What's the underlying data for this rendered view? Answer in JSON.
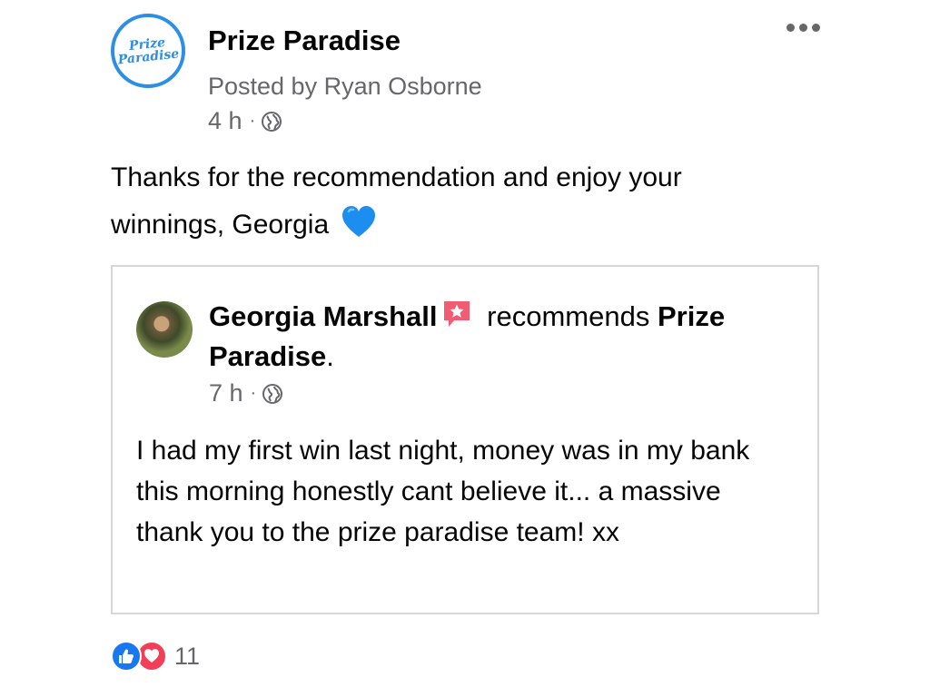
{
  "post": {
    "page_name": "Prize Paradise",
    "logo_text": [
      "Prize",
      "Paradise"
    ],
    "posted_by": "Posted by Ryan Osborne",
    "time": "4 h",
    "separator": "·",
    "privacy_icon": "globe-icon",
    "more_icon": "more-options-icon",
    "text": "Thanks for the recommendation and enjoy your winnings, Georgia",
    "text_emoji": "blue-heart-icon"
  },
  "shared": {
    "author": "Georgia Marshall",
    "badge_icon": "recommendation-star-icon",
    "verb": "recommends",
    "target": "Prize Paradise",
    "period": ".",
    "time": "7 h",
    "separator": "·",
    "privacy_icon": "globe-icon",
    "text": "I had my first win last night, money was in my bank this morning honestly cant believe it... a massive thank you to the prize paradise team! xx"
  },
  "reactions": {
    "icons": [
      "like-icon",
      "love-icon"
    ],
    "count": "11"
  },
  "colors": {
    "accent": "#2d8ee6",
    "secondary_text": "#65676b",
    "like": "#1877f2",
    "love": "#f33e58",
    "border": "#d4d6da"
  }
}
